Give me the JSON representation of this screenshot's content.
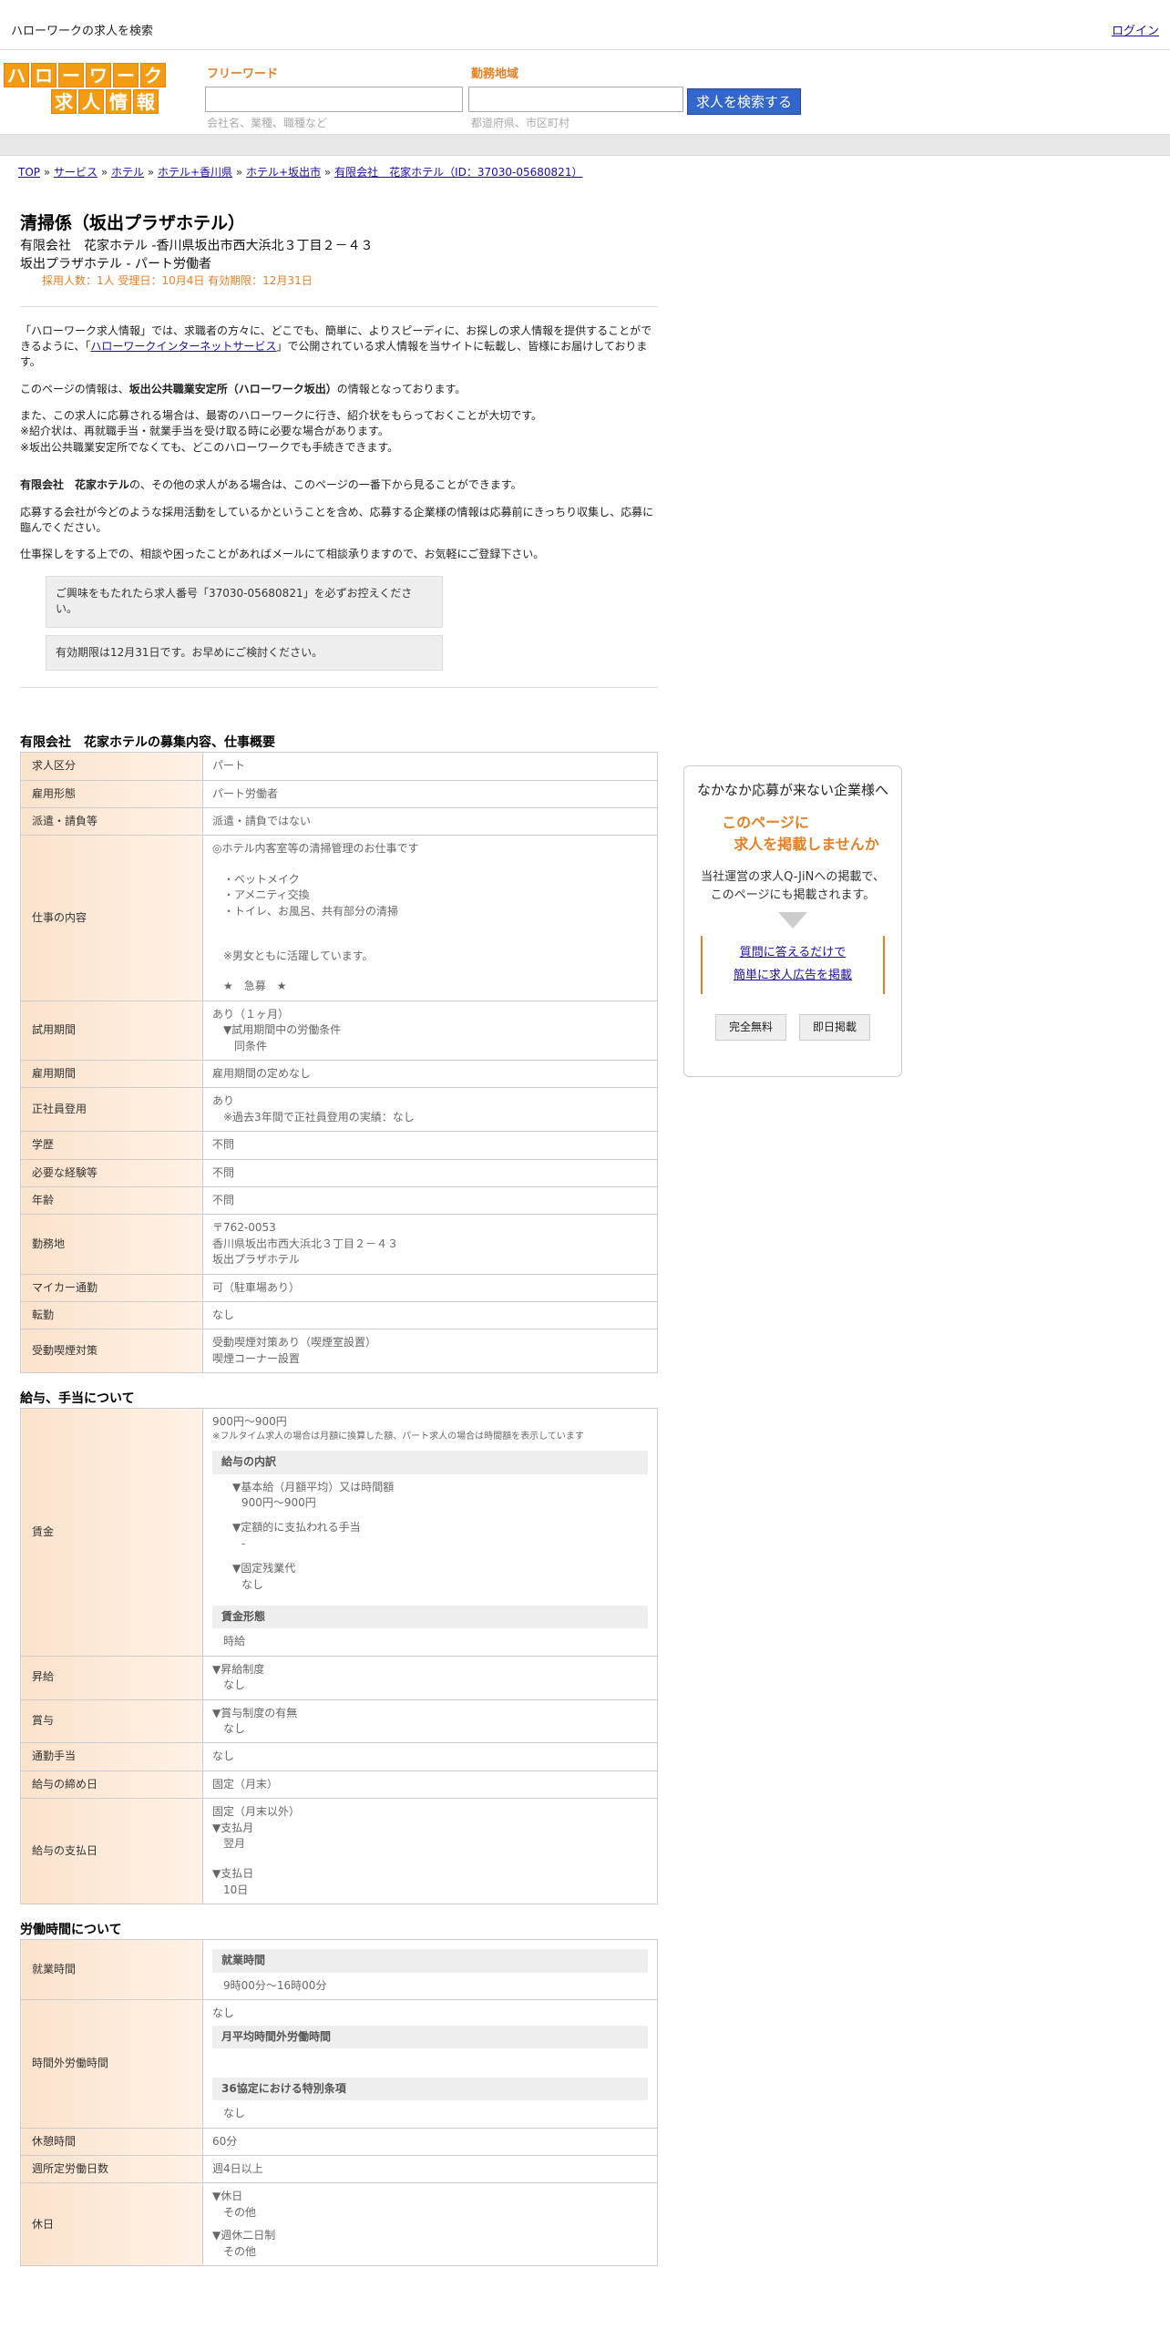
{
  "topbar": {
    "site_title": "ハローワークの求人を検索",
    "login": "ログイン"
  },
  "logo": {
    "row1": [
      "ハ",
      "ロ",
      "ー",
      "ワ",
      "ー",
      "ク"
    ],
    "row2": [
      "求",
      "人",
      "情",
      "報"
    ]
  },
  "search": {
    "freeword_label": "フリーワード",
    "freeword_placeholder": "会社名、業種、職種など",
    "area_label": "勤務地域",
    "area_placeholder": "都道府県、市区町村",
    "button": "求人を検索する"
  },
  "breadcrumb": {
    "items": [
      "TOP",
      "サービス",
      "ホテル",
      "ホテル+香川県",
      "ホテル+坂出市",
      "有限会社　花家ホテル（ID：37030-05680821）"
    ],
    "sep": " » "
  },
  "job": {
    "title": "清掃係（坂出プラザホテル）",
    "company_line": "有限会社　花家ホテル -香川県坂出市西大浜北３丁目２－４３",
    "place_line": "坂出プラザホテル - パート労働者",
    "meta": "採用人数：1人  受理日：10月4日  有効期限：12月31日"
  },
  "intro": {
    "p1_a": "「ハローワーク求人情報」では、求職者の方々に、どこでも、簡単に、よりスピーディに、お探しの求人情報を提供することができるように、「",
    "p1_link": "ハローワークインターネットサービス",
    "p1_b": "」で公開されている求人情報を当サイトに転載し、皆様にお届けしております。",
    "p2_a": "このページの情報は、",
    "p2_bold": "坂出公共職業安定所（ハローワーク坂出）",
    "p2_b": "の情報となっております。",
    "p3_l1": "また、この求人に応募される場合は、最寄のハローワークに行き、紹介状をもらっておくことが大切です。",
    "p3_l2": "※紹介状は、再就職手当・就業手当を受け取る時に必要な場合があります。",
    "p3_l3": "※坂出公共職業安定所でなくても、どこのハローワークでも手続きできます。",
    "p4_bold": "有限会社　花家ホテル",
    "p4_b": "の、その他の求人がある場合は、このページの一番下から見ることができます。",
    "p5": "応募する会社が今どのような採用活動をしているかということを含め、応募する企業様の情報は応募前にきっちり収集し、応募に臨んでください。",
    "p6": "仕事探しをする上での、相談や困ったことがあればメールにて相談承りますので、お気軽にご登録下さい。",
    "notice1": "ご興味をもたれたら求人番号「37030-05680821」を必ずお控えください。",
    "notice2": "有効期限は12月31日です。お早めにご検討ください。"
  },
  "overview": {
    "title": "有限会社　花家ホテルの募集内容、仕事概要",
    "rows": [
      {
        "k": "求人区分",
        "v": [
          "パート"
        ]
      },
      {
        "k": "雇用形態",
        "v": [
          "パート労働者"
        ]
      },
      {
        "k": "派遣・請負等",
        "v": [
          "派遣・請負ではない"
        ]
      },
      {
        "k": "仕事の内容",
        "v": [
          "◎ホテル内客室等の清掃管理のお仕事です",
          "",
          "　・ベットメイク",
          "　・アメニティ交換",
          "　・トイレ、お風呂、共有部分の清掃",
          "",
          "",
          "　※男女ともに活躍しています。",
          "",
          "　★　急募　★"
        ]
      },
      {
        "k": "試用期間",
        "v": [
          "あり（１ヶ月）",
          "　▼試用期間中の労働条件",
          "　　同条件"
        ]
      },
      {
        "k": "雇用期間",
        "v": [
          "雇用期間の定めなし"
        ]
      },
      {
        "k": "正社員登用",
        "v": [
          "あり",
          "　※過去3年間で正社員登用の実績：なし"
        ]
      },
      {
        "k": "学歴",
        "v": [
          "不問"
        ]
      },
      {
        "k": "必要な経験等",
        "v": [
          "不問"
        ]
      },
      {
        "k": "年齢",
        "v": [
          "不問"
        ]
      },
      {
        "k": "勤務地",
        "v": [
          "〒762-0053",
          "香川県坂出市西大浜北３丁目２－４３",
          "坂出プラザホテル"
        ]
      },
      {
        "k": "マイカー通勤",
        "v": [
          "可（駐車場あり）"
        ]
      },
      {
        "k": "転勤",
        "v": [
          "なし"
        ]
      },
      {
        "k": "受動喫煙対策",
        "v": [
          "受動喫煙対策あり（喫煙室設置）",
          "喫煙コーナー設置"
        ]
      }
    ]
  },
  "salary": {
    "title": "給与、手当について",
    "wage_label": "賃金",
    "wage_value": "900円〜900円",
    "wage_note": "※フルタイム求人の場合は月額に換算した額、パート求人の場合は時間額を表示しています",
    "breakdown_title": "給与の内訳",
    "base_label": "▼基本給（月額平均）又は時間額",
    "base_value": "900円〜900円",
    "fixed_label": "▼定額的に支払われる手当",
    "fixed_value": "-",
    "overtime_label": "▼固定残業代",
    "overtime_value": "なし",
    "form_title": "賃金形態",
    "form_value": "時給",
    "rows": [
      {
        "k": "昇給",
        "v": [
          "▼昇給制度",
          "　なし"
        ]
      },
      {
        "k": "賞与",
        "v": [
          "▼賞与制度の有無",
          "　なし"
        ]
      },
      {
        "k": "通勤手当",
        "v": [
          "なし"
        ]
      },
      {
        "k": "給与の締め日",
        "v": [
          "固定（月末）"
        ]
      },
      {
        "k": "給与の支払日",
        "v": [
          "固定（月末以外）",
          "▼支払月",
          "　翌月",
          "",
          "▼支払日",
          "　10日"
        ]
      }
    ]
  },
  "hours": {
    "title": "労働時間について",
    "work_label": "就業時間",
    "work_sub": "就業時間",
    "work_value": "9時00分〜16時00分",
    "ot_label": "時間外労働時間",
    "ot_value": "なし",
    "ot_sub1": "月平均時間外労働時間",
    "ot_sub2": "36協定における特別条項",
    "ot_sub2_value": "なし",
    "rest_label": "休憩時間",
    "rest_value": "60分",
    "days_label": "週所定労働日数",
    "days_value": "週4日以上",
    "holiday_label": "休日",
    "holiday_lines": [
      "▼休日",
      "　その他",
      "",
      "▼週休二日制",
      "　その他"
    ]
  },
  "sidebar": {
    "heading": "なかなか応募が来ない企業様へ",
    "offer_l1": "このページに",
    "offer_l2": "求人を掲載しませんか",
    "desc_l1": "当社運営の求人Q-JiNへの掲載で、",
    "desc_l2": "このページにも掲載されます。",
    "link1": "質問に答えるだけで",
    "link2": "簡単に求人広告を掲載",
    "btn1": "完全無料",
    "btn2": "即日掲載"
  }
}
